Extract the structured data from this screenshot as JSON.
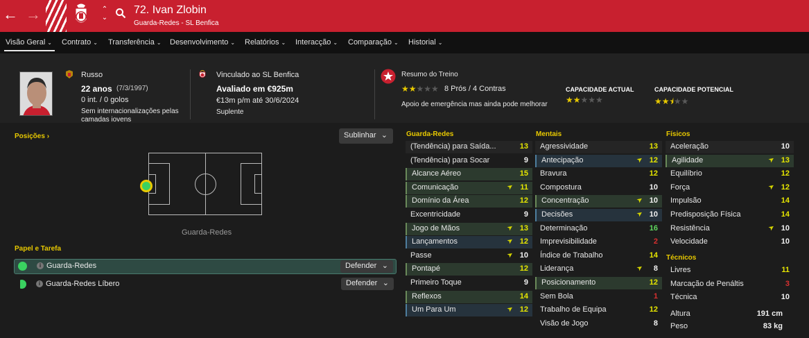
{
  "topbar": {
    "back_icon": "back-arrow-icon",
    "forward_icon": "forward-arrow-icon",
    "title": "72. Ivan Zlobin",
    "subtitle": "Guarda-Redes - SL Benfica"
  },
  "tabs": [
    {
      "label": "Visão Geral"
    },
    {
      "label": "Contrato"
    },
    {
      "label": "Transferência"
    },
    {
      "label": "Desenvolvimento"
    },
    {
      "label": "Relatórios"
    },
    {
      "label": "Interacção"
    },
    {
      "label": "Comparação"
    },
    {
      "label": "Historial"
    }
  ],
  "profile": {
    "nationality": "Russo",
    "age": "22 anos",
    "dob": "(7/3/1997)",
    "caps": "0 int. / 0 golos",
    "intl_note": "Sem internacionalizações pelas",
    "intl_note2": "camadas jovens",
    "club_line": "Vinculado ao SL Benfica",
    "value": "Avaliado em €925m",
    "wage": "€13m p/m até 30/6/2024",
    "squad_status": "Suplente"
  },
  "training": {
    "title": "Resumo do Treino",
    "rating_stars": 2,
    "pros_cons": "8 Prós / 4 Contras",
    "note": "Apoio de emergência mas ainda pode melhorar",
    "current_label": "CAPACIDADE ACTUAL",
    "current_stars": 2,
    "potential_label": "CAPACIDADE POTENCIAL",
    "potential_stars": 2.5
  },
  "positions": {
    "title": "Posições",
    "highlight_button": "Sublinhar",
    "pitch_label": "Guarda-Redes"
  },
  "roles": {
    "title": "Papel e Tarefa",
    "items": [
      {
        "name": "Guarda-Redes",
        "duty": "Defender"
      },
      {
        "name": "Guarda-Redes Líbero",
        "duty": "Defender"
      }
    ]
  },
  "attributes": {
    "goalkeeping": {
      "title": "Guarda-Redes",
      "rows": [
        {
          "name": "(Tendência) para Saída...",
          "value": "13",
          "color": "yellow",
          "hl": "alt",
          "arrow": false
        },
        {
          "name": "(Tendência) para Socar",
          "value": "9",
          "color": "white",
          "hl": "",
          "arrow": false
        },
        {
          "name": "Alcance Aéreo",
          "value": "15",
          "color": "yellow",
          "hl": "green",
          "arrow": false
        },
        {
          "name": "Comunicação",
          "value": "11",
          "color": "yellow",
          "hl": "green",
          "arrow": true
        },
        {
          "name": "Domínio da Área",
          "value": "12",
          "color": "yellow",
          "hl": "green",
          "arrow": false
        },
        {
          "name": "Excentricidade",
          "value": "9",
          "color": "white",
          "hl": "",
          "arrow": false
        },
        {
          "name": "Jogo de Mãos",
          "value": "13",
          "color": "yellow",
          "hl": "green",
          "arrow": true
        },
        {
          "name": "Lançamentos",
          "value": "12",
          "color": "yellow",
          "hl": "blue",
          "arrow": true
        },
        {
          "name": "Passe",
          "value": "10",
          "color": "white",
          "hl": "",
          "arrow": true
        },
        {
          "name": "Pontapé",
          "value": "12",
          "color": "yellow",
          "hl": "green",
          "arrow": false
        },
        {
          "name": "Primeiro Toque",
          "value": "9",
          "color": "white",
          "hl": "",
          "arrow": false
        },
        {
          "name": "Reflexos",
          "value": "14",
          "color": "yellow",
          "hl": "green",
          "arrow": false
        },
        {
          "name": "Um Para Um",
          "value": "12",
          "color": "yellow",
          "hl": "blue",
          "arrow": true
        }
      ]
    },
    "mental": {
      "title": "Mentais",
      "rows": [
        {
          "name": "Agressividade",
          "value": "13",
          "color": "yellow",
          "hl": "alt",
          "arrow": false
        },
        {
          "name": "Antecipação",
          "value": "12",
          "color": "yellow",
          "hl": "blue",
          "arrow": true
        },
        {
          "name": "Bravura",
          "value": "12",
          "color": "yellow",
          "hl": "",
          "arrow": false
        },
        {
          "name": "Compostura",
          "value": "10",
          "color": "white",
          "hl": "",
          "arrow": false
        },
        {
          "name": "Concentração",
          "value": "10",
          "color": "white",
          "hl": "green",
          "arrow": true
        },
        {
          "name": "Decisões",
          "value": "10",
          "color": "white",
          "hl": "blue",
          "arrow": true
        },
        {
          "name": "Determinação",
          "value": "16",
          "color": "green",
          "hl": "",
          "arrow": false
        },
        {
          "name": "Imprevisibilidade",
          "value": "2",
          "color": "red",
          "hl": "",
          "arrow": false
        },
        {
          "name": "Índice de Trabalho",
          "value": "14",
          "color": "yellow",
          "hl": "",
          "arrow": false
        },
        {
          "name": "Liderança",
          "value": "8",
          "color": "white",
          "hl": "",
          "arrow": true
        },
        {
          "name": "Posicionamento",
          "value": "12",
          "color": "yellow",
          "hl": "green",
          "arrow": false
        },
        {
          "name": "Sem Bola",
          "value": "1",
          "color": "red",
          "hl": "",
          "arrow": false
        },
        {
          "name": "Trabalho de Equipa",
          "value": "12",
          "color": "yellow",
          "hl": "",
          "arrow": false
        },
        {
          "name": "Visão de Jogo",
          "value": "8",
          "color": "white",
          "hl": "",
          "arrow": false
        }
      ]
    },
    "physical": {
      "title": "Físicos",
      "rows": [
        {
          "name": "Aceleração",
          "value": "10",
          "color": "white",
          "hl": "alt",
          "arrow": false
        },
        {
          "name": "Agilidade",
          "value": "13",
          "color": "yellow",
          "hl": "green",
          "arrow": true
        },
        {
          "name": "Equilíbrio",
          "value": "12",
          "color": "yellow",
          "hl": "",
          "arrow": false
        },
        {
          "name": "Força",
          "value": "12",
          "color": "yellow",
          "hl": "",
          "arrow": true
        },
        {
          "name": "Impulsão",
          "value": "14",
          "color": "yellow",
          "hl": "",
          "arrow": false
        },
        {
          "name": "Predisposição Física",
          "value": "14",
          "color": "yellow",
          "hl": "",
          "arrow": false
        },
        {
          "name": "Resistência",
          "value": "10",
          "color": "white",
          "hl": "",
          "arrow": true
        },
        {
          "name": "Velocidade",
          "value": "10",
          "color": "white",
          "hl": "",
          "arrow": false
        }
      ]
    },
    "technical": {
      "title": "Técnicos",
      "rows": [
        {
          "name": "Livres",
          "value": "11",
          "color": "yellow",
          "hl": "",
          "arrow": false
        },
        {
          "name": "Marcação de Penáltis",
          "value": "3",
          "color": "red",
          "hl": "",
          "arrow": false
        },
        {
          "name": "Técnica",
          "value": "10",
          "color": "white",
          "hl": "",
          "arrow": false
        }
      ]
    },
    "body": [
      {
        "name": "Altura",
        "value": "191 cm"
      },
      {
        "name": "Peso",
        "value": "83 kg"
      }
    ]
  },
  "colors": {
    "brand_red": "#c8202f",
    "yellow": "#e8c900"
  }
}
